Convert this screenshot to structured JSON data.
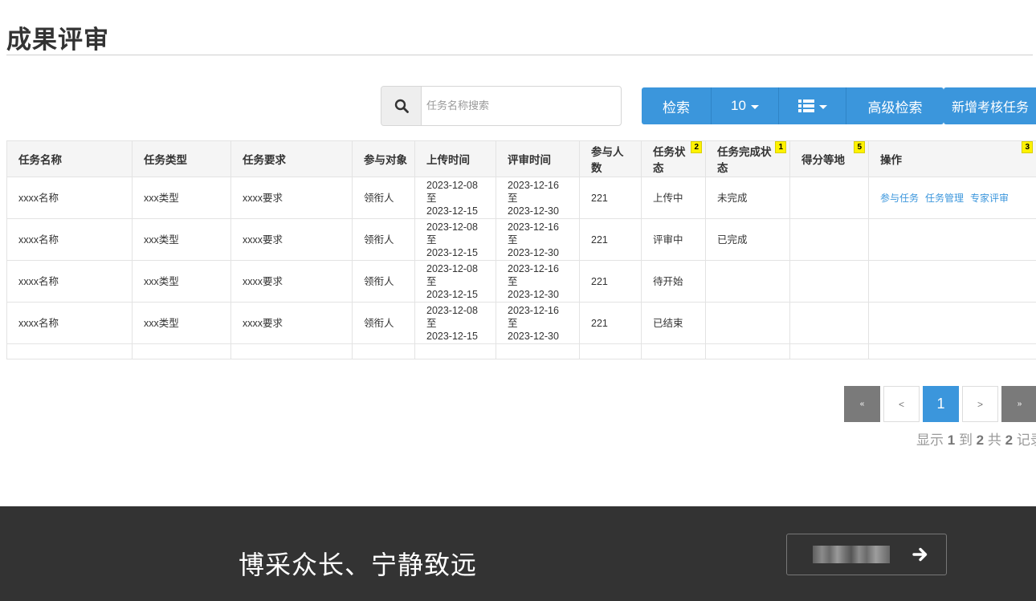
{
  "page": {
    "title": "成果评审"
  },
  "search": {
    "placeholder": "任务名称搜索"
  },
  "toolbar": {
    "search_label": "检索",
    "page_size": "10",
    "columns_icon": "list-icon",
    "advanced_label": "高级检索",
    "new_task_label": "新增考核任务",
    "accent_color": "#3b96dc"
  },
  "table": {
    "headers": [
      "任务名称",
      "任务类型",
      "任务要求",
      "参与对象",
      "上传时间",
      "评审时间",
      "参与人数",
      "任务状态",
      "任务完成状态",
      "得分等地",
      "操作"
    ],
    "badges": {
      "task_status": "2",
      "completion_status": "1",
      "score": "5",
      "ops": "3"
    },
    "rows": [
      {
        "name": "xxxx名称",
        "type": "xxx类型",
        "req": "xxxx要求",
        "target": "领衔人",
        "upload": [
          "2023-12-08至",
          "2023-12-15"
        ],
        "review": [
          "2023-12-16至",
          "2023-12-30"
        ],
        "count": "221",
        "status": "上传中",
        "completion": "未完成",
        "score": "",
        "ops": [
          "参与任务",
          "任务管理",
          "专家评审"
        ]
      },
      {
        "name": "xxxx名称",
        "type": "xxx类型",
        "req": "xxxx要求",
        "target": "领衔人",
        "upload": [
          "2023-12-08至",
          "2023-12-15"
        ],
        "review": [
          "2023-12-16至",
          "2023-12-30"
        ],
        "count": "221",
        "status": "评审中",
        "completion": "已完成",
        "score": "",
        "ops": []
      },
      {
        "name": "xxxx名称",
        "type": "xxx类型",
        "req": "xxxx要求",
        "target": "领衔人",
        "upload": [
          "2023-12-08至",
          "2023-12-15"
        ],
        "review": [
          "2023-12-16至",
          "2023-12-30"
        ],
        "count": "221",
        "status": "待开始",
        "completion": "",
        "score": "",
        "ops": []
      },
      {
        "name": "xxxx名称",
        "type": "xxx类型",
        "req": "xxxx要求",
        "target": "领衔人",
        "upload": [
          "2023-12-08至",
          "2023-12-15"
        ],
        "review": [
          "2023-12-16至",
          "2023-12-30"
        ],
        "count": "221",
        "status": "已结束",
        "completion": "",
        "score": "",
        "ops": []
      }
    ]
  },
  "pagination": {
    "first": "«",
    "prev": "<",
    "current": "1",
    "next": ">",
    "last": "»",
    "info": {
      "prefix": "显示",
      "from": "1",
      "to_word": "到",
      "to": "2",
      "total_word": "共",
      "total": "2",
      "suffix": "记录"
    }
  },
  "footer": {
    "slogan": "博采众长、宁静致远",
    "bg_color": "#333333"
  }
}
